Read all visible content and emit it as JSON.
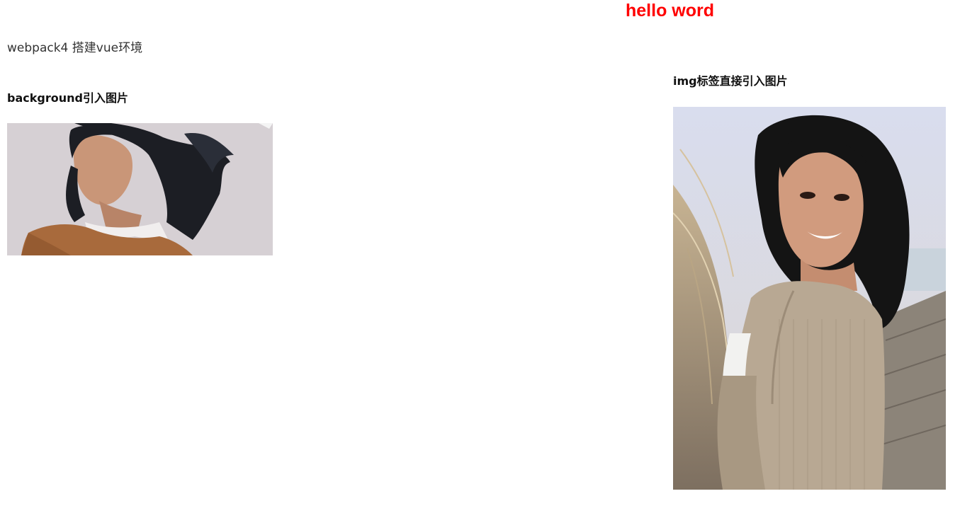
{
  "header": {
    "hello_text": "hello word"
  },
  "intro": {
    "subtitle": "webpack4 搭建vue环境"
  },
  "background_section": {
    "heading": "background引入图片"
  },
  "img_section": {
    "heading": "img标签直接引入图片"
  },
  "colors": {
    "accent_red": "#ff0000"
  }
}
